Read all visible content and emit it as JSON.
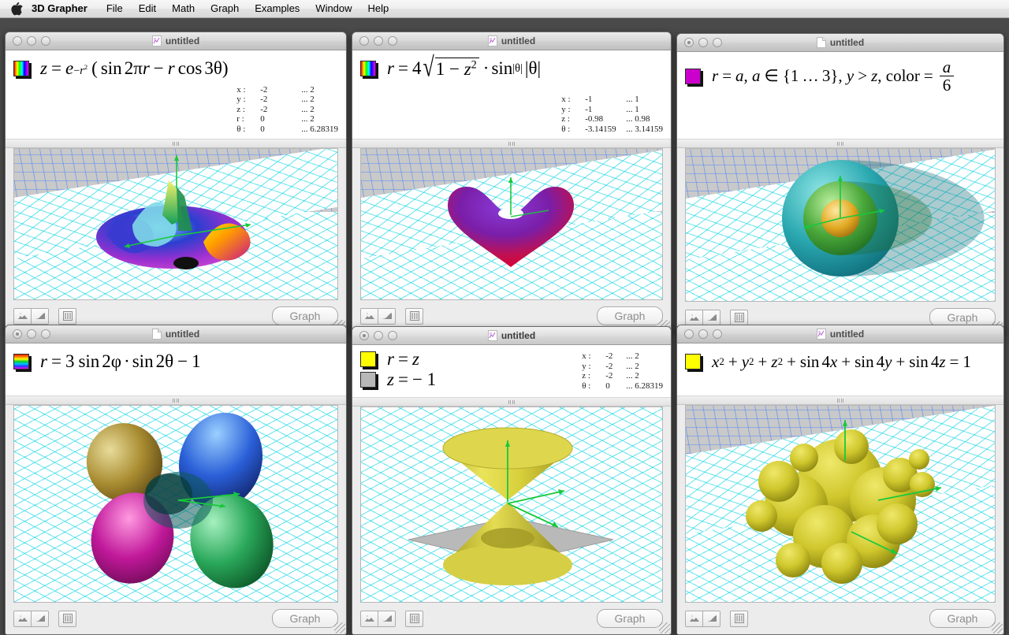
{
  "menubar": {
    "apple_icon": "apple-logo-icon",
    "app_name": "3D Grapher",
    "items": [
      "File",
      "Edit",
      "Math",
      "Graph",
      "Examples",
      "Window",
      "Help"
    ]
  },
  "common": {
    "window_title": "untitled",
    "graph_button_label": "Graph",
    "icons": {
      "surface_plot_icon": "surface-plot-icon",
      "line_plot_icon": "line-plot-icon",
      "columns_icon": "columns-icon",
      "resize_grip_icon": "resize-grip-icon",
      "splitter_handle_icon": "splitter-handle-icon"
    }
  },
  "colors": {
    "desktop": "#4a4a4a",
    "menubar_text": "#000000",
    "window_chrome": "#ececec",
    "plot_wall": "#c9c9c9",
    "plot_wall_grid": "#4682ff",
    "plot_floor_grid": "#00d2e1",
    "axis_green": "#22cc44",
    "graph_button_text": "#8e8e8e",
    "swatch_magenta": "#cc00cc",
    "swatch_yellow": "#ffff00",
    "swatch_gray": "#b8b8b8"
  },
  "windows": [
    {
      "id": "win-1",
      "title": "untitled",
      "active": false,
      "title_icon": "graph-document-icon",
      "equations": [
        {
          "swatch": "rainbow-vertical",
          "text": "z = e^(-r^2) ( sin 2πr − r cos 3θ )"
        }
      ],
      "ranges": [
        {
          "var": "x :",
          "min": "-2",
          "max": "... 2"
        },
        {
          "var": "y :",
          "min": "-2",
          "max": "... 2"
        },
        {
          "var": "z :",
          "min": "-2",
          "max": "... 2"
        },
        {
          "var": "r :",
          "min": "0",
          "max": "... 2"
        },
        {
          "var": "θ :",
          "min": "0",
          "max": "... 6.28319"
        }
      ]
    },
    {
      "id": "win-2",
      "title": "untitled",
      "active": false,
      "title_icon": "graph-document-icon",
      "equations": [
        {
          "swatch": "rainbow-vertical",
          "text": "r = 4 √(1 − z^2) · sin^|θ| |θ|"
        }
      ],
      "ranges": [
        {
          "var": "x :",
          "min": "-1",
          "max": "... 1"
        },
        {
          "var": "y :",
          "min": "-1",
          "max": "... 1"
        },
        {
          "var": "z :",
          "min": "-0.98",
          "max": "... 0.98"
        },
        {
          "var": "θ :",
          "min": "-3.14159",
          "max": "... 3.14159"
        }
      ]
    },
    {
      "id": "win-3",
      "title": "untitled",
      "active": false,
      "title_icon": "blank-document-icon",
      "equations": [
        {
          "swatch": "magenta",
          "text": "r = a, a ∈ {1 … 3}, y > z, color = a/6"
        }
      ],
      "ranges": []
    },
    {
      "id": "win-4",
      "title": "untitled",
      "active": false,
      "title_icon": "blank-document-icon",
      "equations": [
        {
          "swatch": "rainbow-horizontal",
          "text": "r = 3 sin 2ϕ · sin 2θ − 1"
        }
      ],
      "ranges": []
    },
    {
      "id": "win-5",
      "title": "untitled",
      "active": true,
      "title_icon": "graph-document-icon",
      "equations": [
        {
          "swatch": "yellow",
          "text": "r = z"
        },
        {
          "swatch": "gray",
          "text": "z = − 1"
        }
      ],
      "ranges": [
        {
          "var": "x :",
          "min": "-2",
          "max": "... 2"
        },
        {
          "var": "y :",
          "min": "-2",
          "max": "... 2"
        },
        {
          "var": "z :",
          "min": "-2",
          "max": "... 2"
        },
        {
          "var": "θ :",
          "min": "0",
          "max": "... 6.28319"
        }
      ]
    },
    {
      "id": "win-6",
      "title": "untitled",
      "active": false,
      "title_icon": "graph-document-icon",
      "equations": [
        {
          "swatch": "yellow",
          "text": "x^2 + y^2 + z^2 + sin 4x + sin 4y + sin 4z = 1"
        }
      ],
      "ranges": []
    }
  ]
}
